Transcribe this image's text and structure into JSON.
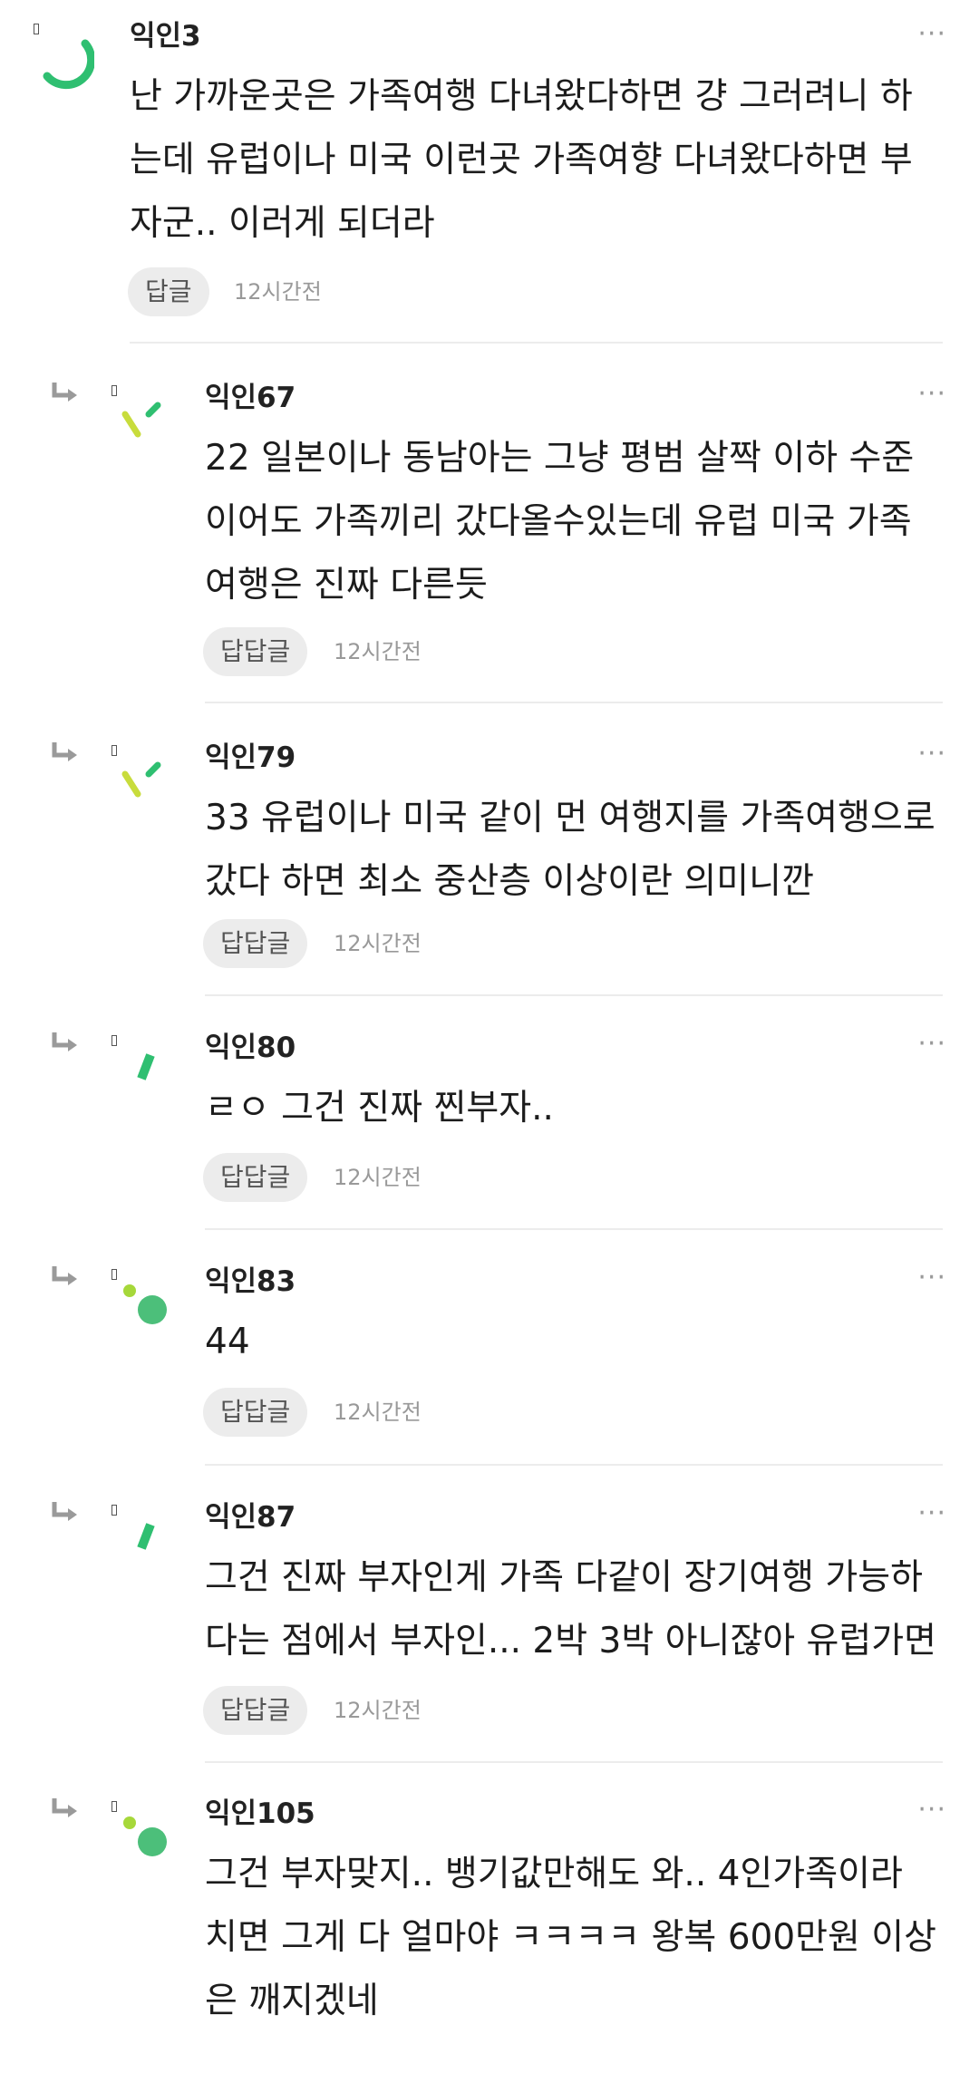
{
  "comments": [
    {
      "author": "익인3",
      "text": "난 가까운곳은 가족여행 다녀왔다하면 걍 그러려니 하\n는데 유럽이나 미국 이런곳 가족여향 다녀왔다하면 부\n자군.. 이러게 되더라",
      "reply_label": "답글",
      "time": "12시간전",
      "is_reply": false,
      "avatar": "arc"
    },
    {
      "author": "익인67",
      "text": "22 일본이나 동남아는 그냥 평범 살짝 이하 수준\n이어도 가족끼리 갔다올수있는데 유럽 미국 가족\n여행은 진짜 다른듯",
      "reply_label": "답답글",
      "time": "12시간전",
      "is_reply": true,
      "avatar": "ticks"
    },
    {
      "author": "익인79",
      "text": "33 유럽이나 미국 같이 먼 여행지를 가족여행으로\n갔다 하면 최소 중산층 이상이란 의미니깐",
      "reply_label": "답답글",
      "time": "12시간전",
      "is_reply": true,
      "avatar": "ticks"
    },
    {
      "author": "익인80",
      "text": "ㄹㅇ 그건 진짜 찐부자..",
      "reply_label": "답답글",
      "time": "12시간전",
      "is_reply": true,
      "avatar": "stroke"
    },
    {
      "author": "익인83",
      "text": "44",
      "reply_label": "답답글",
      "time": "12시간전",
      "is_reply": true,
      "avatar": "dots"
    },
    {
      "author": "익인87",
      "text": "그건 진짜 부자인게 가족 다같이 장기여행 가능하\n다는 점에서 부자인... 2박 3박 아니잖아 유럽가면",
      "reply_label": "답답글",
      "time": "12시간전",
      "is_reply": true,
      "avatar": "stroke"
    },
    {
      "author": "익인105",
      "text": "그건 부자맞지.. 뱅기값만해도 와.. 4인가족이라\n치면 그게 다 얼마야 ㅋㅋㅋㅋ 왕복 600만원 이상\n은 깨지겠네",
      "reply_label": "",
      "time": "",
      "is_reply": true,
      "avatar": "dots"
    }
  ],
  "more_label": "···",
  "colors": {
    "green": "#2fbf71",
    "lime": "#c8dc3c",
    "light_green": "#a6d83a",
    "mint": "#4cbf7a"
  }
}
